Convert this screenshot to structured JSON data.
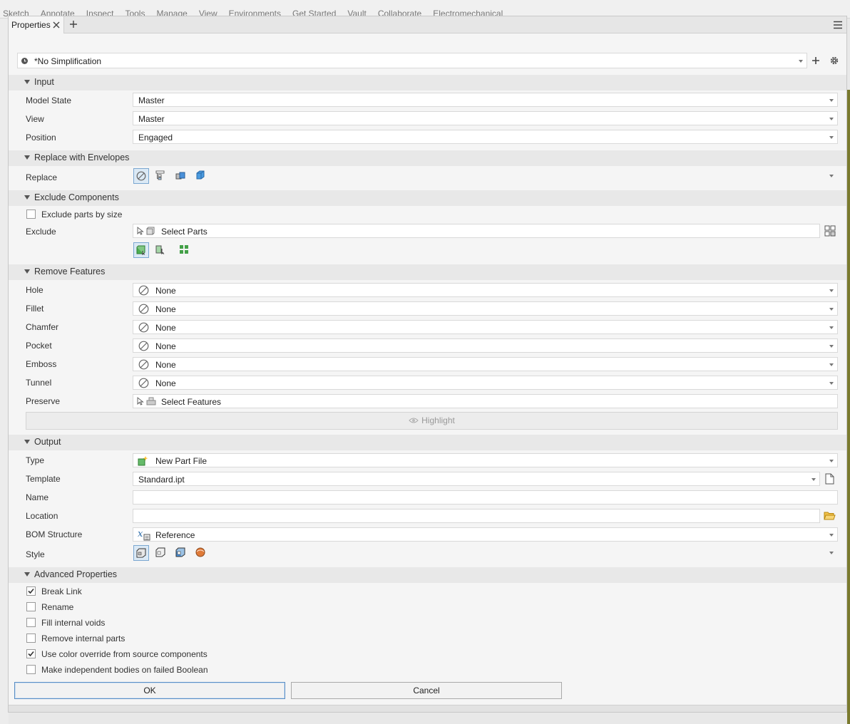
{
  "background": {
    "ribbon_tabs": [
      "Sketch",
      "Annotate",
      "Inspect",
      "Tools",
      "Manage",
      "View",
      "Environments",
      "Get Started",
      "Vault",
      "Collaborate",
      "Electromechanical"
    ]
  },
  "panel": {
    "tab_title": "Properties",
    "preset": {
      "value": "*No Simplification"
    }
  },
  "input": {
    "title": "Input",
    "rows": [
      {
        "label": "Model State",
        "value": "Master"
      },
      {
        "label": "View",
        "value": "Master"
      },
      {
        "label": "Position",
        "value": "Engaged"
      }
    ]
  },
  "envelopes": {
    "title": "Replace with Envelopes",
    "replace_label": "Replace"
  },
  "exclude": {
    "title": "Exclude Components",
    "by_size_label": "Exclude parts by size",
    "by_size_checked": false,
    "exclude_label": "Exclude",
    "select_parts": "Select Parts"
  },
  "remove": {
    "title": "Remove Features",
    "rows": [
      {
        "label": "Hole",
        "value": "None"
      },
      {
        "label": "Fillet",
        "value": "None"
      },
      {
        "label": "Chamfer",
        "value": "None"
      },
      {
        "label": "Pocket",
        "value": "None"
      },
      {
        "label": "Emboss",
        "value": "None"
      },
      {
        "label": "Tunnel",
        "value": "None"
      }
    ],
    "preserve_label": "Preserve",
    "select_features": "Select Features",
    "highlight": "Highlight"
  },
  "output": {
    "title": "Output",
    "type_label": "Type",
    "type_value": "New Part File",
    "template_label": "Template",
    "template_value": "Standard.ipt",
    "name_label": "Name",
    "name_value": "",
    "location_label": "Location",
    "location_value": "",
    "bom_label": "BOM Structure",
    "bom_value": "Reference",
    "style_label": "Style"
  },
  "advanced": {
    "title": "Advanced Properties",
    "options": [
      {
        "label": "Break Link",
        "checked": true
      },
      {
        "label": "Rename",
        "checked": false
      },
      {
        "label": "Fill internal voids",
        "checked": false
      },
      {
        "label": "Remove internal parts",
        "checked": false
      },
      {
        "label": "Use color override from source components",
        "checked": true
      },
      {
        "label": "Make independent bodies on failed Boolean",
        "checked": false
      }
    ]
  },
  "buttons": {
    "ok": "OK",
    "cancel": "Cancel"
  },
  "colors": {
    "accent": "#5b8ec4",
    "selected_bg": "#dbe9f5",
    "section_bg": "#e8e8e8"
  }
}
